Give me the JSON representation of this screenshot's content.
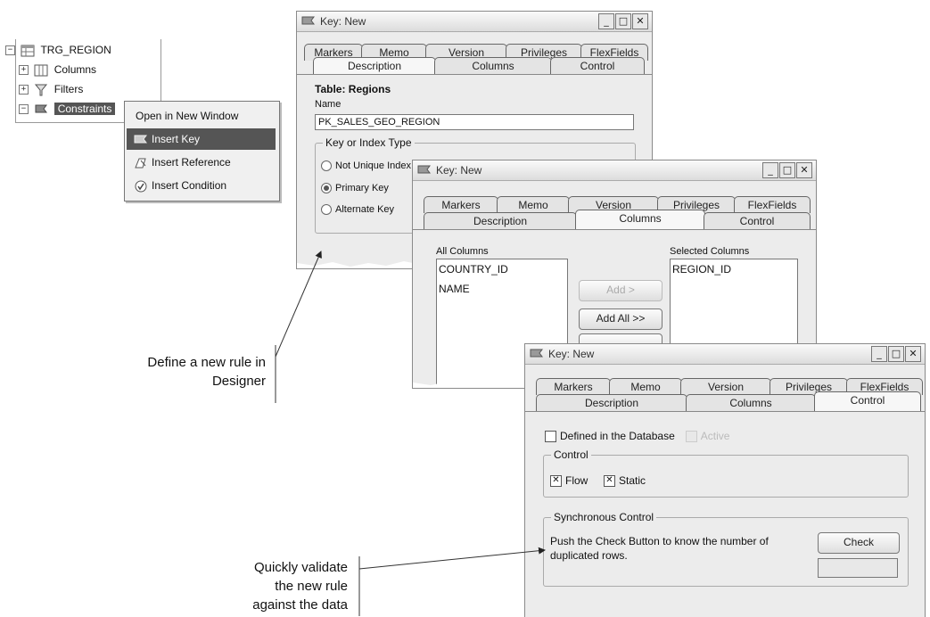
{
  "tree": {
    "root": "TRG_REGION",
    "items": [
      "Columns",
      "Filters",
      "Constraints"
    ]
  },
  "context_menu": {
    "items": [
      "Open in New Window",
      "Insert Key",
      "Insert Reference",
      "Insert Condition"
    ]
  },
  "dialog_title": "Key: New",
  "tabs_top": [
    "Markers",
    "Memo",
    "Version",
    "Privileges",
    "FlexFields"
  ],
  "tabs_bottom": [
    "Description",
    "Columns",
    "Control"
  ],
  "description_tab": {
    "table_label": "Table: Regions",
    "name_label": "Name",
    "name_value": "PK_SALES_GEO_REGION",
    "group_title": "Key or Index Type",
    "options": [
      "Not Unique Index",
      "Primary Key",
      "Alternate Key"
    ],
    "selected_option": "Primary Key"
  },
  "columns_tab": {
    "all_columns_label": "All Columns",
    "all_columns": [
      "COUNTRY_ID",
      "NAME"
    ],
    "selected_columns_label": "Selected Columns",
    "selected_columns": [
      "REGION_ID"
    ],
    "add_button": "Add >",
    "add_all_button": "Add All >>"
  },
  "control_tab": {
    "defined_in_db": "Defined in the Database",
    "active": "Active",
    "control_group": "Control",
    "flow": "Flow",
    "static": "Static",
    "sync_group": "Synchronous Control",
    "sync_text_1": "Push the Check Button to know the number of",
    "sync_text_2": "duplicated rows.",
    "check_button": "Check"
  },
  "captions": {
    "define_1": "Define a new rule in",
    "define_2": "Designer",
    "validate_1": "Quickly validate",
    "validate_2": "the new rule",
    "validate_3": "against the data"
  },
  "colors": {
    "selected_menu": "#555555",
    "dialog_bg": "#ececec"
  }
}
